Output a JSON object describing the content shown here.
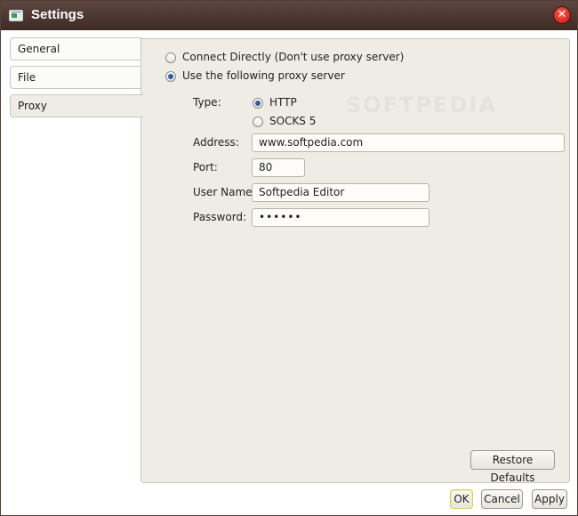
{
  "window": {
    "title": "Settings"
  },
  "tabs": [
    {
      "label": "General"
    },
    {
      "label": "File"
    },
    {
      "label": "Proxy"
    }
  ],
  "proxy": {
    "connect_directly_label": "Connect Directly (Don't use proxy server)",
    "use_proxy_label": "Use the following proxy server",
    "selected_mode": "use_proxy",
    "type_label": "Type:",
    "type_options": [
      "HTTP",
      "SOCKS 5"
    ],
    "type_selected": "HTTP",
    "address_label": "Address:",
    "address_value": "www.softpedia.com",
    "port_label": "Port:",
    "port_value": "80",
    "username_label": "User Name:",
    "username_value": "Softpedia Editor",
    "password_label": "Password:",
    "password_value": "••••••",
    "restore_defaults_label": "Restore Defaults"
  },
  "footer": {
    "ok_label": "OK",
    "cancel_label": "Cancel",
    "apply_label": "Apply"
  },
  "watermark": "SOFTPEDIA",
  "colors": {
    "titlebar": "#4a3630",
    "panel": "#efece5",
    "radio_dot": "#2b5e9c",
    "close": "#d4241a"
  }
}
